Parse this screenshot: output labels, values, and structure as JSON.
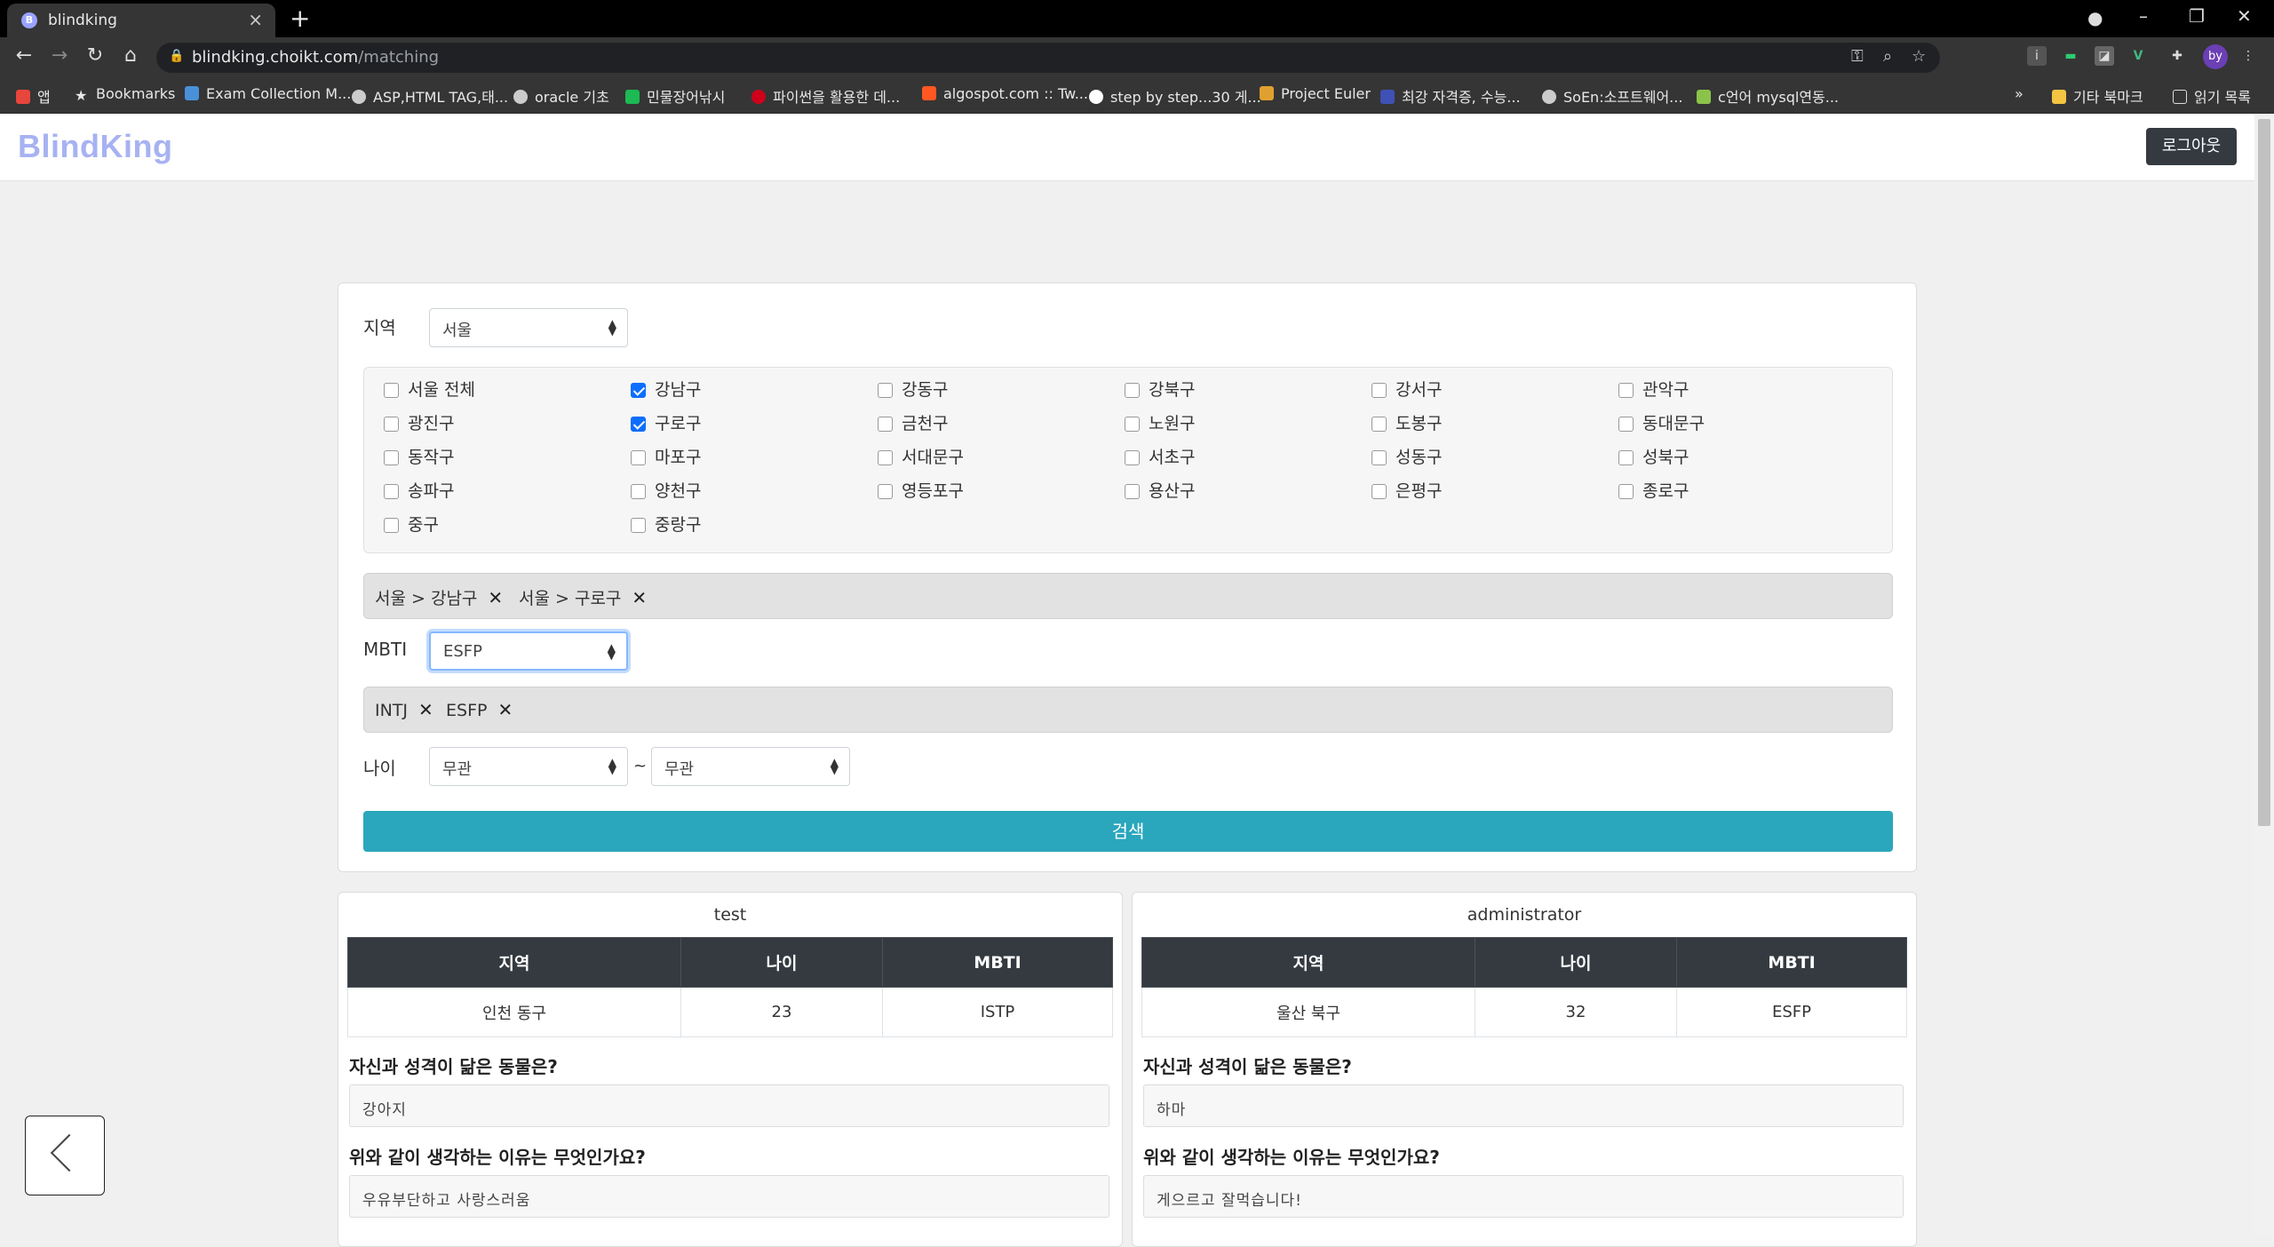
{
  "browser": {
    "tab_title": "blindking",
    "tab_favicon": "B",
    "url_host": "blindking.choikt.com",
    "url_path": "/matching",
    "profile": "by",
    "bookmarks": [
      {
        "label": "앱",
        "color": "#e8453c"
      },
      {
        "label": "Bookmarks",
        "color": "#e8e8e8"
      },
      {
        "label": "Exam Collection M...",
        "color": "#4a90d9"
      },
      {
        "label": "ASP,HTML TAG,태...",
        "color": "#cccccc"
      },
      {
        "label": "oracle 기초",
        "color": "#cccccc"
      },
      {
        "label": "민물장어낚시",
        "color": "#1db954"
      },
      {
        "label": "파이썬을 활용한 데...",
        "color": "#d0021b"
      },
      {
        "label": "algospot.com :: Tw...",
        "color": "#ff5722"
      },
      {
        "label": "step by step...30 게...",
        "color": "#ffffff"
      },
      {
        "label": "Project Euler",
        "color": "#e0a030"
      },
      {
        "label": "최강 자격증, 수능...",
        "color": "#3f51b5"
      },
      {
        "label": "SoEn:소프트웨어...",
        "color": "#cccccc"
      },
      {
        "label": "c언어 mysql연동...",
        "color": "#8bc34a"
      }
    ],
    "bookmarks_more": "»",
    "other_bookmarks": "기타 북마크",
    "reading_list": "읽기 목록"
  },
  "app": {
    "brand": "BlindKing",
    "logout_label": "로그아웃"
  },
  "filters": {
    "region_label": "지역",
    "region_value": "서울",
    "districts": [
      {
        "label": "서울 전체",
        "checked": false
      },
      {
        "label": "강남구",
        "checked": true
      },
      {
        "label": "강동구",
        "checked": false
      },
      {
        "label": "강북구",
        "checked": false
      },
      {
        "label": "강서구",
        "checked": false
      },
      {
        "label": "관악구",
        "checked": false
      },
      {
        "label": "광진구",
        "checked": false
      },
      {
        "label": "구로구",
        "checked": true
      },
      {
        "label": "금천구",
        "checked": false
      },
      {
        "label": "노원구",
        "checked": false
      },
      {
        "label": "도봉구",
        "checked": false
      },
      {
        "label": "동대문구",
        "checked": false
      },
      {
        "label": "동작구",
        "checked": false
      },
      {
        "label": "마포구",
        "checked": false
      },
      {
        "label": "서대문구",
        "checked": false
      },
      {
        "label": "서초구",
        "checked": false
      },
      {
        "label": "성동구",
        "checked": false
      },
      {
        "label": "성북구",
        "checked": false
      },
      {
        "label": "송파구",
        "checked": false
      },
      {
        "label": "양천구",
        "checked": false
      },
      {
        "label": "영등포구",
        "checked": false
      },
      {
        "label": "용산구",
        "checked": false
      },
      {
        "label": "은평구",
        "checked": false
      },
      {
        "label": "종로구",
        "checked": false
      },
      {
        "label": "중구",
        "checked": false
      },
      {
        "label": "중랑구",
        "checked": false
      }
    ],
    "region_tags": [
      "서울 > 강남구",
      "서울 > 구로구"
    ],
    "mbti_label": "MBTI",
    "mbti_value": "ESFP",
    "mbti_tags": [
      "INTJ",
      "ESFP"
    ],
    "age_label": "나이",
    "age_min": "무관",
    "age_sep": "~",
    "age_max": "무관",
    "search_label": "검색",
    "tag_remove": "✕"
  },
  "results": [
    {
      "name": "test",
      "headers": [
        "지역",
        "나이",
        "MBTI"
      ],
      "region": "인천 동구",
      "age": "23",
      "mbti": "ISTP",
      "q1": "자신과 성격이 닮은 동물은?",
      "a1": "강아지",
      "q2": "위와 같이 생각하는 이유는 무엇인가요?",
      "a2": "우유부단하고 사랑스러움"
    },
    {
      "name": "administrator",
      "headers": [
        "지역",
        "나이",
        "MBTI"
      ],
      "region": "울산 북구",
      "age": "32",
      "mbti": "ESFP",
      "q1": "자신과 성격이 닮은 동물은?",
      "a1": "하마",
      "q2": "위와 같이 생각하는 이유는 무엇인가요?",
      "a2": "게으르고 잘먹습니다!"
    }
  ]
}
